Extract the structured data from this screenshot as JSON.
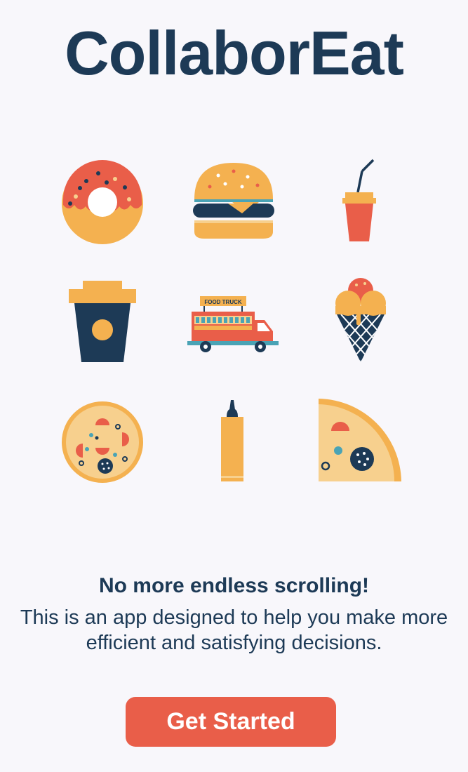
{
  "app": {
    "title": "CollaborEat"
  },
  "illustrations": [
    {
      "name": "donut-icon"
    },
    {
      "name": "burger-icon"
    },
    {
      "name": "soda-cup-icon"
    },
    {
      "name": "coffee-cup-icon"
    },
    {
      "name": "food-truck-icon",
      "label": "FOOD TRUCK"
    },
    {
      "name": "ice-cream-cone-icon"
    },
    {
      "name": "pizza-icon"
    },
    {
      "name": "sauce-bottle-icon"
    },
    {
      "name": "pizza-slice-icon"
    }
  ],
  "intro": {
    "headline": "No more endless scrolling!",
    "description": "This is an app designed to help you make more efficient and satisfying decisions."
  },
  "cta": {
    "label": "Get Started"
  },
  "colors": {
    "navy": "#1d3a56",
    "coral": "#e95e49",
    "mustard": "#f4b150",
    "cream": "#f7d08e",
    "teal": "#4aa3b5",
    "background": "#f8f7fb"
  }
}
